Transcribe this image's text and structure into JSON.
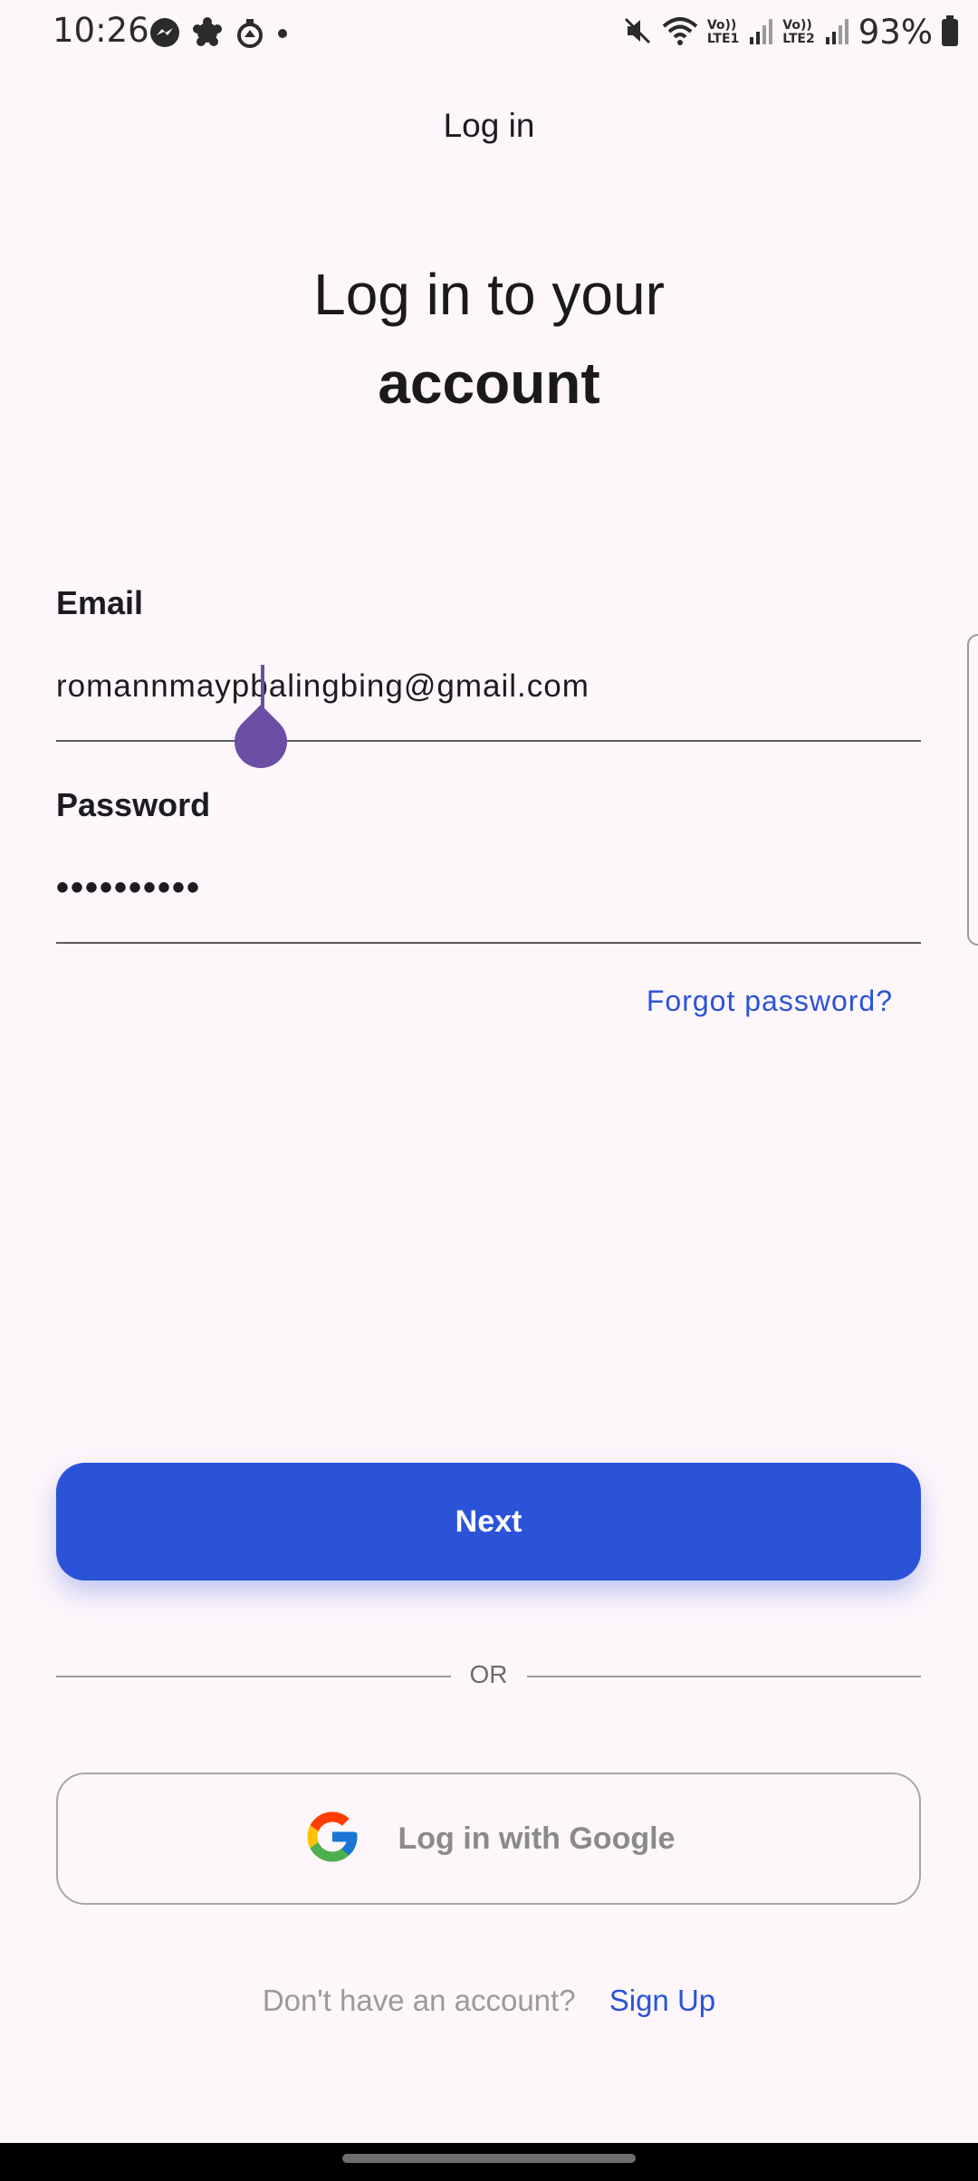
{
  "status_bar": {
    "time": "10:26",
    "battery": "93%",
    "icons_left": [
      "messenger-icon",
      "settings-gear-icon",
      "flask-icon",
      "dot-icon"
    ],
    "icons_right": [
      "mute-icon",
      "wifi-icon",
      "volte-lte1-icon",
      "signal-icon",
      "volte-lte2-icon",
      "signal-icon",
      "battery-icon"
    ],
    "lte1": "Vo)) LTE1",
    "lte2": "Vo)) LTE2"
  },
  "app_bar": {
    "title": "Log in"
  },
  "headline": {
    "line1": "Log in to your",
    "line2": "account"
  },
  "form": {
    "email_label": "Email",
    "email_value": "romannmaypbalingbing@gmail.com",
    "password_label": "Password",
    "password_value": "••••••••••",
    "forgot_label": "Forgot password?"
  },
  "actions": {
    "next_label": "Next",
    "or_label": "OR",
    "google_label": "Log in with Google"
  },
  "signup": {
    "question": "Don't have an account?",
    "link": "Sign Up"
  },
  "colors": {
    "accent": "#2a53d8",
    "background": "#fdf6fb",
    "cursor": "#6a4fa5"
  }
}
